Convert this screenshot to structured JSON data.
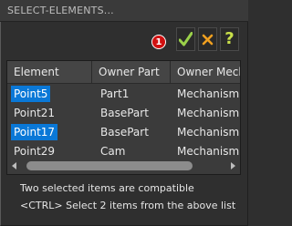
{
  "window": {
    "title": "SELECT-ELEMENTS..."
  },
  "toolbar": {
    "badge": "1",
    "ok_icon": "check-icon",
    "cancel_icon": "close-icon",
    "help_label": "?",
    "colors": {
      "ok": "#9bd14a",
      "cancel": "#f0a020",
      "help": "#c9e04a",
      "badge": "#d01010"
    }
  },
  "grid": {
    "columns": [
      "Element",
      "Owner Part",
      "Owner Mech"
    ],
    "rows": [
      {
        "element": "Point5",
        "owner_part": "Part1",
        "owner_mech": "Mechanism",
        "selected": true
      },
      {
        "element": "Point21",
        "owner_part": "BasePart",
        "owner_mech": "Mechanism",
        "selected": false
      },
      {
        "element": "Point17",
        "owner_part": "BasePart",
        "owner_mech": "Mechanism",
        "selected": true
      },
      {
        "element": "Point29",
        "owner_part": "Cam",
        "owner_mech": "Mechanism",
        "selected": false
      }
    ],
    "selection_color": "#0a78d7"
  },
  "status": {
    "line1": "Two selected items are compatible",
    "line2": "<CTRL> Select 2 items from the above list"
  }
}
